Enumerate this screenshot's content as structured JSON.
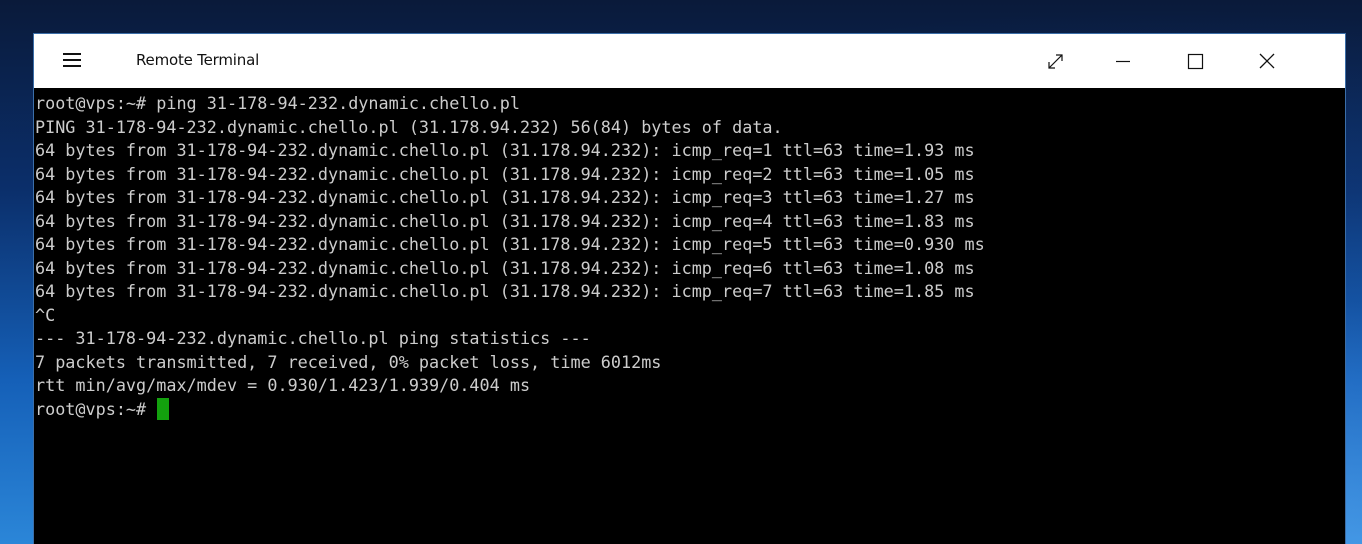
{
  "window": {
    "title": "Remote Terminal",
    "icons": {
      "menu": "hamburger-menu-icon",
      "fullscreen": "expand-diagonal-icon",
      "minimize": "minimize-icon",
      "maximize": "maximize-icon",
      "close": "close-icon"
    }
  },
  "terminal": {
    "lines": [
      "root@vps:~# ping 31-178-94-232.dynamic.chello.pl",
      "PING 31-178-94-232.dynamic.chello.pl (31.178.94.232) 56(84) bytes of data.",
      "64 bytes from 31-178-94-232.dynamic.chello.pl (31.178.94.232): icmp_req=1 ttl=63 time=1.93 ms",
      "64 bytes from 31-178-94-232.dynamic.chello.pl (31.178.94.232): icmp_req=2 ttl=63 time=1.05 ms",
      "64 bytes from 31-178-94-232.dynamic.chello.pl (31.178.94.232): icmp_req=3 ttl=63 time=1.27 ms",
      "64 bytes from 31-178-94-232.dynamic.chello.pl (31.178.94.232): icmp_req=4 ttl=63 time=1.83 ms",
      "64 bytes from 31-178-94-232.dynamic.chello.pl (31.178.94.232): icmp_req=5 ttl=63 time=0.930 ms",
      "64 bytes from 31-178-94-232.dynamic.chello.pl (31.178.94.232): icmp_req=6 ttl=63 time=1.08 ms",
      "64 bytes from 31-178-94-232.dynamic.chello.pl (31.178.94.232): icmp_req=7 ttl=63 time=1.85 ms",
      "^C",
      "--- 31-178-94-232.dynamic.chello.pl ping statistics ---",
      "7 packets transmitted, 7 received, 0% packet loss, time 6012ms",
      "rtt min/avg/max/mdev = 0.930/1.423/1.939/0.404 ms"
    ],
    "prompt": "root@vps:~# ",
    "colors": {
      "background": "#000000",
      "foreground": "#cccccc",
      "cursor": "#13a10e"
    }
  }
}
